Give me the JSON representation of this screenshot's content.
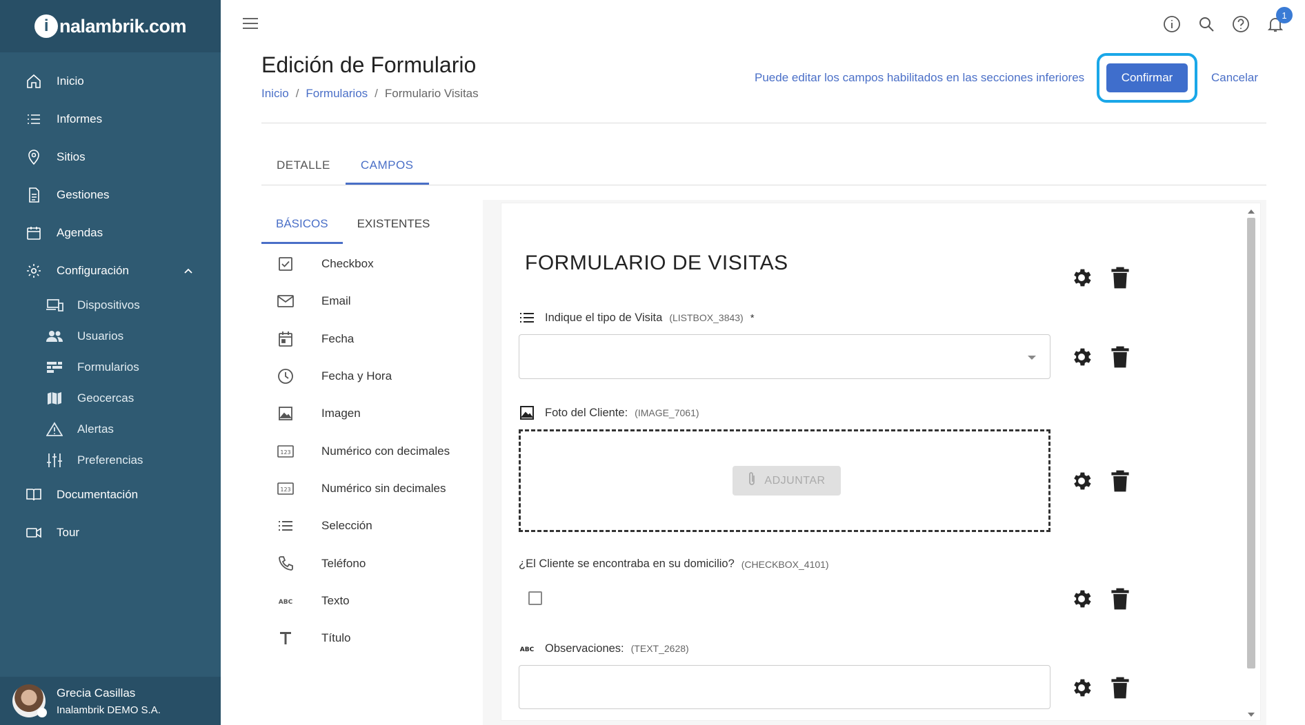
{
  "brand": {
    "logo_letter": "i",
    "logo_text": "nalambrik.com"
  },
  "sidebar": {
    "items": [
      {
        "label": "Inicio",
        "icon": "home-icon"
      },
      {
        "label": "Informes",
        "icon": "list-icon"
      },
      {
        "label": "Sitios",
        "icon": "location-pin-icon"
      },
      {
        "label": "Gestiones",
        "icon": "document-icon"
      },
      {
        "label": "Agendas",
        "icon": "calendar-icon"
      },
      {
        "label": "Configuración",
        "icon": "gear-icon",
        "expanded": true
      }
    ],
    "sub_items": [
      {
        "label": "Dispositivos",
        "icon": "devices-icon"
      },
      {
        "label": "Usuarios",
        "icon": "users-icon"
      },
      {
        "label": "Formularios",
        "icon": "forms-icon"
      },
      {
        "label": "Geocercas",
        "icon": "map-icon"
      },
      {
        "label": "Alertas",
        "icon": "warning-icon"
      },
      {
        "label": "Preferencias",
        "icon": "sliders-icon"
      }
    ],
    "bottom_items": [
      {
        "label": "Documentación",
        "icon": "book-icon"
      },
      {
        "label": "Tour",
        "icon": "video-icon"
      }
    ],
    "user": {
      "name": "Grecia Casillas",
      "org": "Inalambrik DEMO S.A."
    }
  },
  "topbar": {
    "notification_count": "1",
    "icons": [
      "info-icon",
      "search-icon",
      "help-icon",
      "bell-icon"
    ]
  },
  "header": {
    "title": "Edición de Formulario",
    "breadcrumb": [
      "Inicio",
      "Formularios",
      "Formulario Visitas"
    ],
    "hint": "Puede editar los campos habilitados en las secciones inferiores",
    "confirm_label": "Confirmar",
    "cancel_label": "Cancelar"
  },
  "tabs": [
    {
      "label": "DETALLE",
      "active": false
    },
    {
      "label": "CAMPOS",
      "active": true
    }
  ],
  "subtabs": [
    {
      "label": "BÁSICOS",
      "active": true
    },
    {
      "label": "EXISTENTES",
      "active": false
    }
  ],
  "field_types": [
    {
      "label": "Checkbox",
      "icon": "checkbox-icon"
    },
    {
      "label": "Email",
      "icon": "email-icon"
    },
    {
      "label": "Fecha",
      "icon": "calendar-icon"
    },
    {
      "label": "Fecha y Hora",
      "icon": "clock-icon"
    },
    {
      "label": "Imagen",
      "icon": "image-icon"
    },
    {
      "label": "Numérico con decimales",
      "icon": "numeric-icon"
    },
    {
      "label": "Numérico sin decimales",
      "icon": "numeric-icon"
    },
    {
      "label": "Selección",
      "icon": "list-icon"
    },
    {
      "label": "Teléfono",
      "icon": "phone-icon"
    },
    {
      "label": "Texto",
      "icon": "text-abc-icon"
    },
    {
      "label": "Título",
      "icon": "title-t-icon"
    }
  ],
  "form": {
    "title": "FORMULARIO DE VISITAS",
    "fields": [
      {
        "label": "Indique el tipo de Visita",
        "code": "(LISTBOX_3843)",
        "required": "*",
        "type": "select",
        "value": ""
      },
      {
        "label": "Foto del Cliente:",
        "code": "(IMAGE_7061)",
        "type": "image",
        "attach_label": "ADJUNTAR"
      },
      {
        "label": "¿El Cliente se encontraba en su domicilio?",
        "code": "(CHECKBOX_4101)",
        "type": "checkbox",
        "checked": false
      },
      {
        "label": "Observaciones:",
        "code": "(TEXT_2628)",
        "type": "text",
        "value": ""
      }
    ]
  },
  "colors": {
    "sidebar": "#2f5a72",
    "accent": "#4a6fc7",
    "confirm": "#3f6ecc",
    "highlight": "#1aa7e8"
  }
}
